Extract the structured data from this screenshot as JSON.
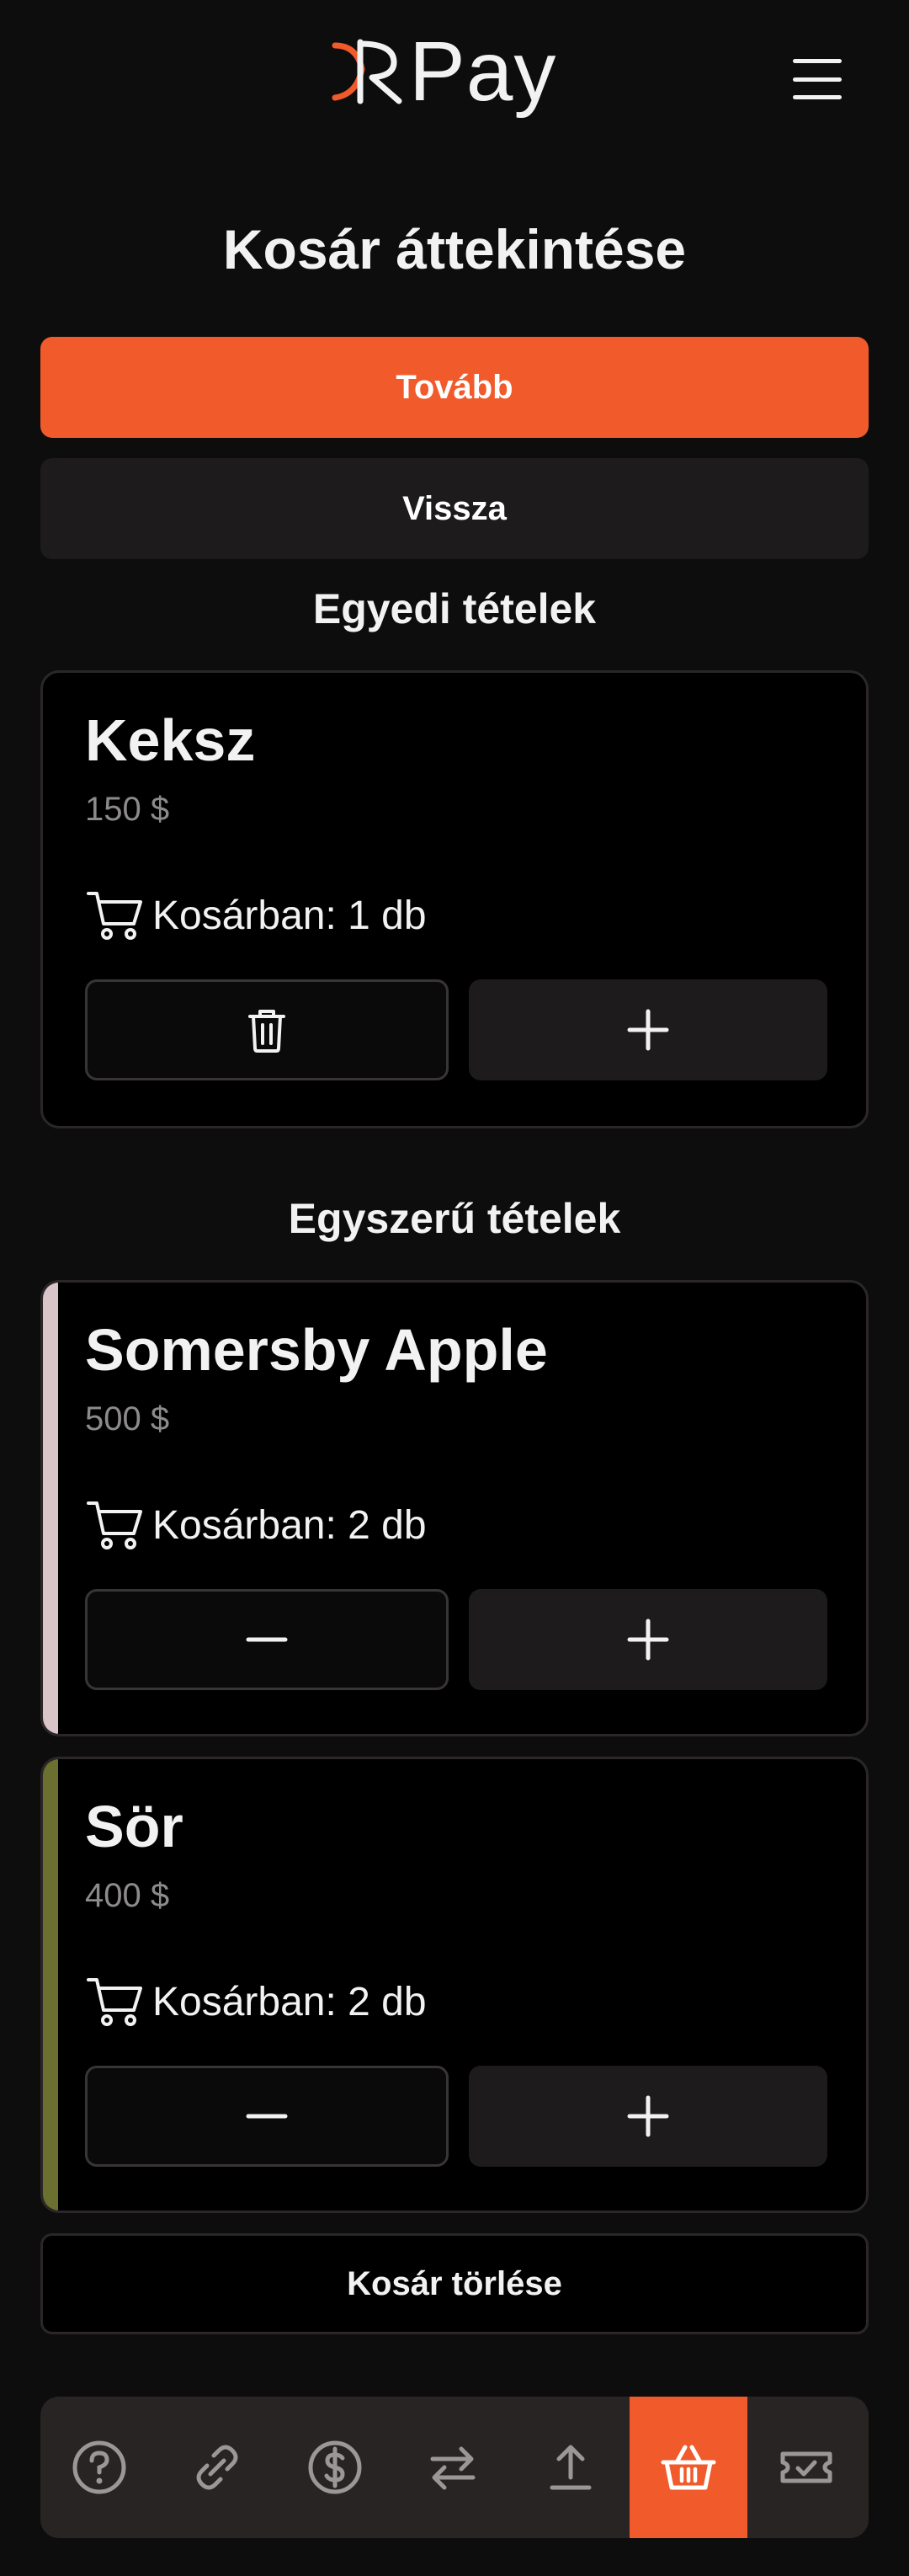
{
  "header": {
    "logo_text": "Pay",
    "brand_color": "#f15a2b"
  },
  "page": {
    "title": "Kosár áttekintése"
  },
  "actions": {
    "next_label": "Tovább",
    "back_label": "Vissza"
  },
  "sections": {
    "single_title": "Egyedi tételek",
    "simple_title": "Egyszerű tételek"
  },
  "items": [
    {
      "name": "Keksz",
      "price": "150 $",
      "in_cart": "Kosárban: 1 db",
      "left_action": "trash-icon",
      "right_action": "plus-icon"
    },
    {
      "name": "Somersby Apple",
      "price": "500 $",
      "in_cart": "Kosárban: 2 db",
      "accent_color": "#d9c5c9",
      "left_action": "minus-icon",
      "right_action": "plus-icon"
    },
    {
      "name": "Sör",
      "price": "400 $",
      "in_cart": "Kosárban: 2 db",
      "accent_color": "#6b6f2f",
      "left_action": "minus-icon",
      "right_action": "plus-icon"
    }
  ],
  "clear_cart_label": "Kosár törlése",
  "bottom_nav": [
    {
      "icon": "help-icon",
      "active": false
    },
    {
      "icon": "link-icon",
      "active": false
    },
    {
      "icon": "dollar-icon",
      "active": false
    },
    {
      "icon": "transfer-icon",
      "active": false
    },
    {
      "icon": "upload-icon",
      "active": false
    },
    {
      "icon": "basket-icon",
      "active": true
    },
    {
      "icon": "ticket-icon",
      "active": false
    }
  ]
}
